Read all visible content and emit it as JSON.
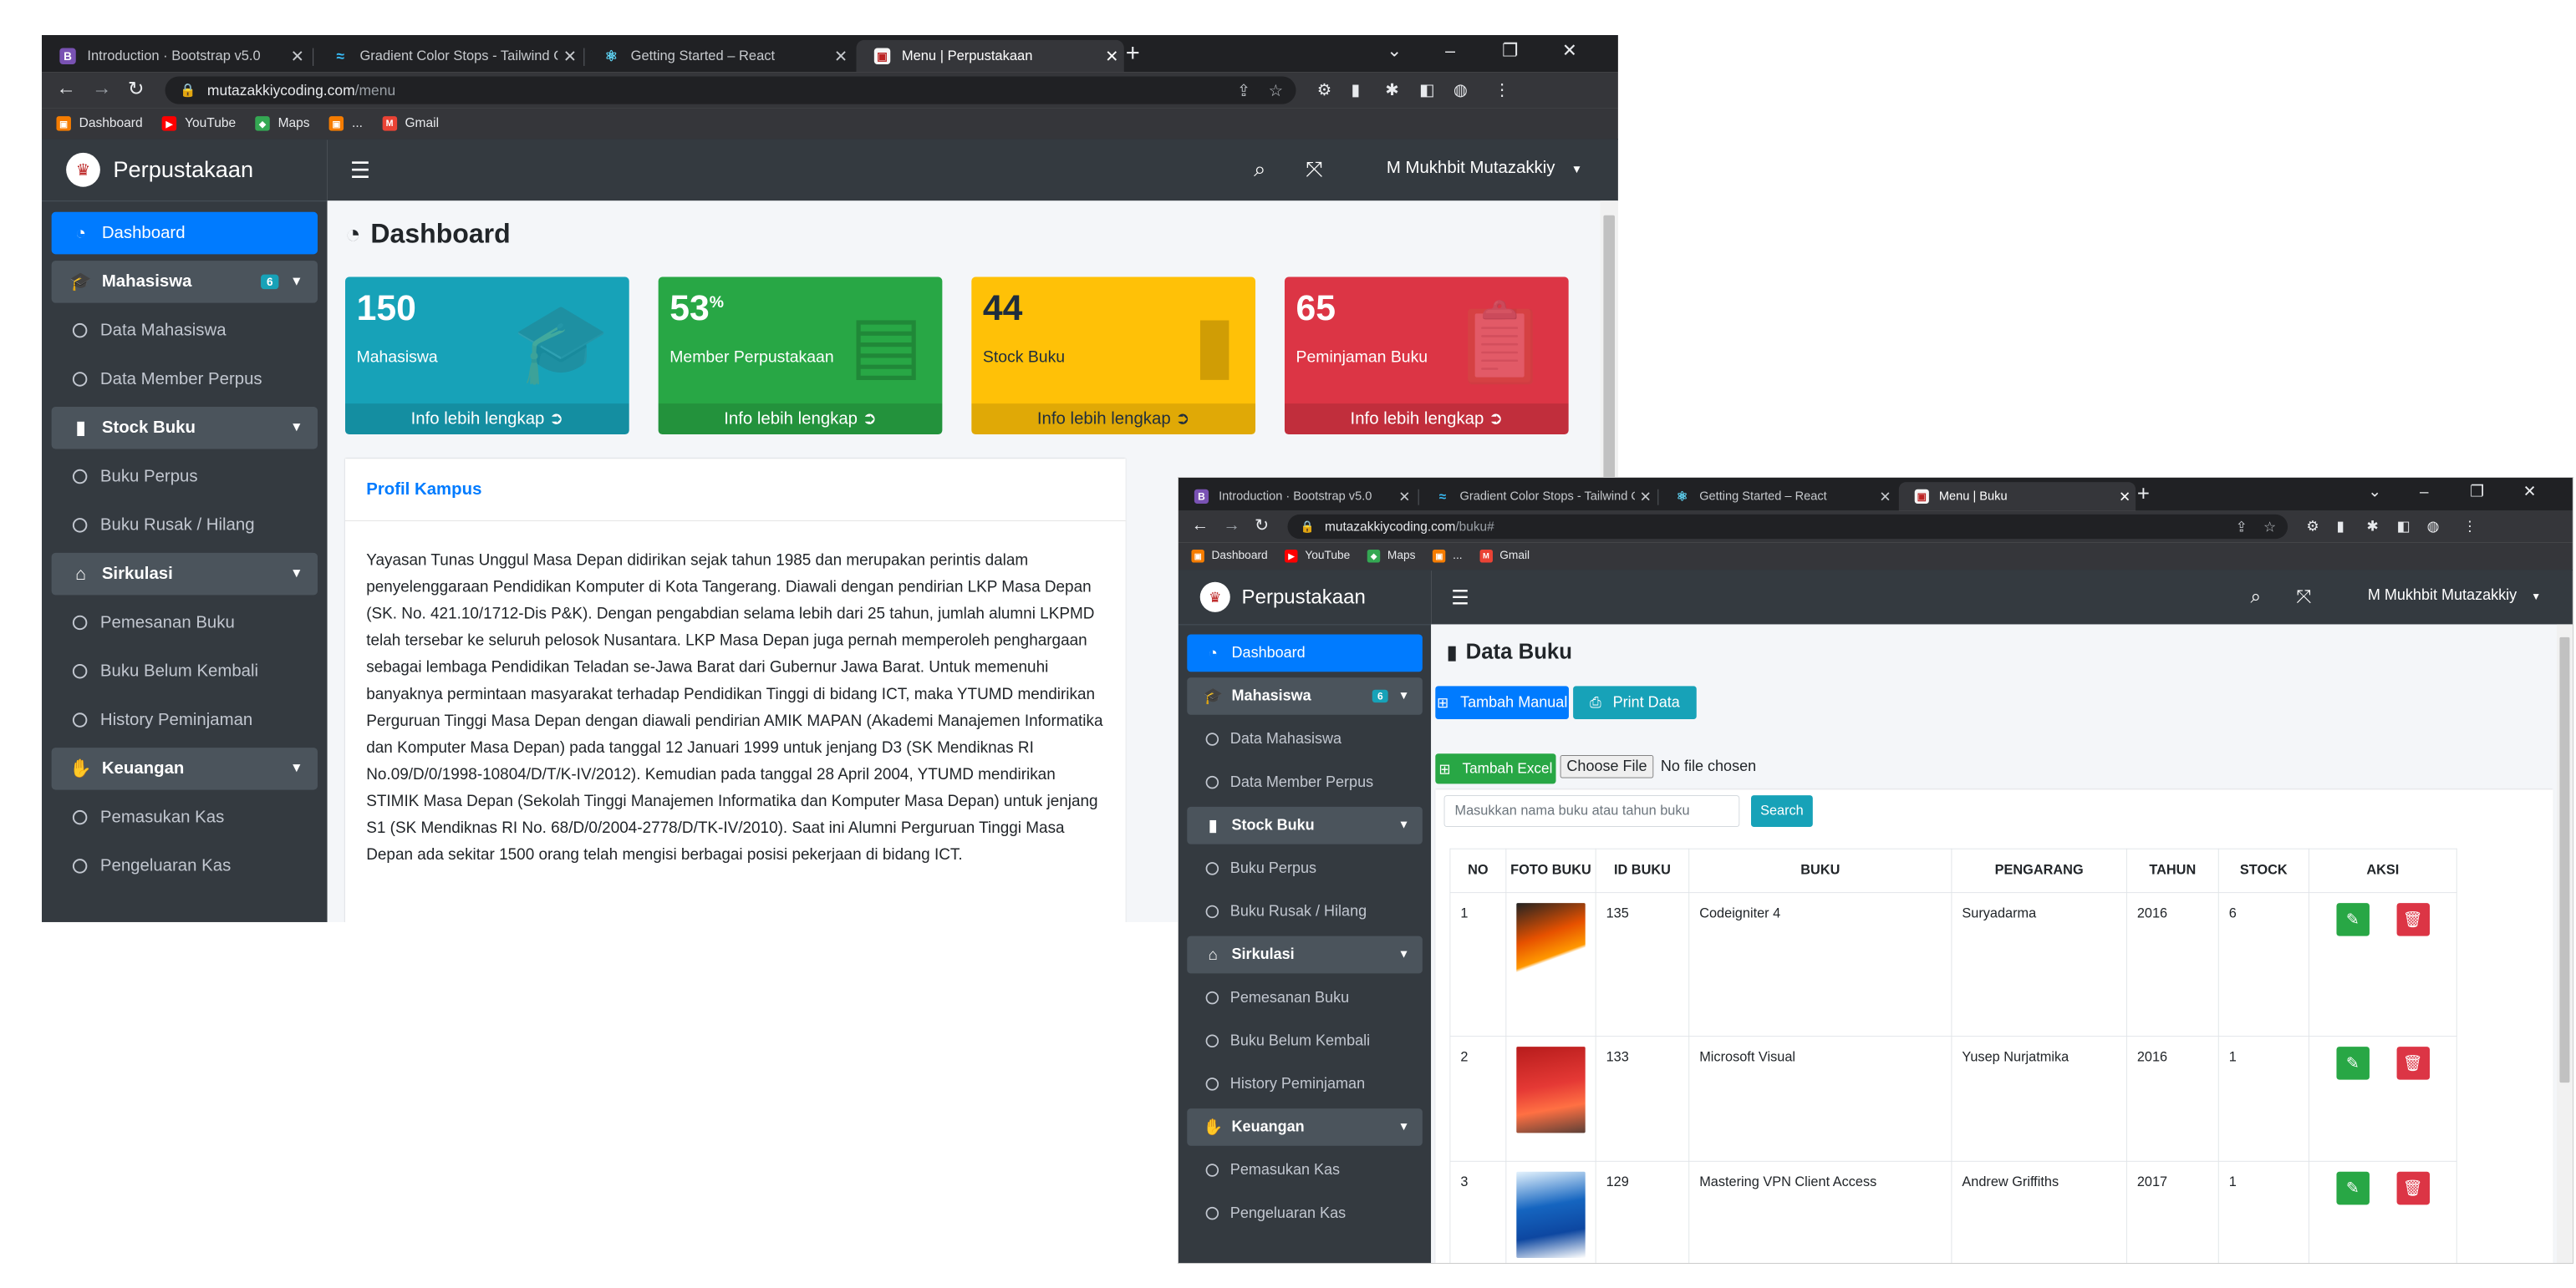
{
  "browser": {
    "tabs": [
      {
        "title": "Introduction · Bootstrap v5.0",
        "icon": "bootstrap-icon"
      },
      {
        "title": "Gradient Color Stops - Tailwind C",
        "icon": "tailwind-icon"
      },
      {
        "title": "Getting Started – React",
        "icon": "react-icon"
      }
    ],
    "bookmarks": [
      "Dashboard",
      "YouTube",
      "Maps",
      "...",
      "Gmail"
    ]
  },
  "window1": {
    "active_tab_title": "Menu | Perpustakaan",
    "url_host": "mutazakkiycoding.com",
    "url_path": "/menu"
  },
  "window2": {
    "active_tab_title": "Menu | Buku",
    "url_host": "mutazakkiycoding.com",
    "url_path": "/buku#"
  },
  "app": {
    "brand": "Perpustakaan",
    "user_name": "M Mukhbit Mutazakkiy",
    "sidebar": [
      {
        "label": "Dashboard",
        "type": "active",
        "icon": "dashboard-icon"
      },
      {
        "label": "Mahasiswa",
        "type": "group",
        "icon": "graduate-icon",
        "badge": "6"
      },
      {
        "label": "Data Mahasiswa",
        "type": "item"
      },
      {
        "label": "Data Member Perpus",
        "type": "item"
      },
      {
        "label": "Stock Buku",
        "type": "group",
        "icon": "book-icon"
      },
      {
        "label": "Buku Perpus",
        "type": "item"
      },
      {
        "label": "Buku Rusak / Hilang",
        "type": "item"
      },
      {
        "label": "Sirkulasi",
        "type": "group",
        "icon": "store-icon"
      },
      {
        "label": "Pemesanan Buku",
        "type": "item"
      },
      {
        "label": "Buku Belum Kembali",
        "type": "item"
      },
      {
        "label": "History Peminjaman",
        "type": "item"
      },
      {
        "label": "Keuangan",
        "type": "group",
        "icon": "hand-money-icon"
      },
      {
        "label": "Pemasukan Kas",
        "type": "item"
      },
      {
        "label": "Pengeluaran Kas",
        "type": "item"
      }
    ]
  },
  "dashboard": {
    "title": "Dashboard",
    "boxes": [
      {
        "value": "150",
        "suffix": "",
        "label": "Mahasiswa",
        "footer": "Info lebih lengkap",
        "color": "#17a2b8",
        "icon": "graduate-icon"
      },
      {
        "value": "53",
        "suffix": "%",
        "label": "Member Perpustakaan",
        "footer": "Info lebih lengkap",
        "color": "#28a745",
        "icon": "id-card-icon"
      },
      {
        "value": "44",
        "suffix": "",
        "label": "Stock Buku",
        "footer": "Info lebih lengkap",
        "color": "#ffc107",
        "icon": "book-icon"
      },
      {
        "value": "65",
        "suffix": "",
        "label": "Peminjaman Buku",
        "footer": "Info lebih lengkap",
        "color": "#dc3545",
        "icon": "clipboard-icon"
      }
    ],
    "profile_title": "Profil Kampus",
    "profile_text": "Yayasan Tunas Unggul Masa Depan didirikan sejak tahun 1985 dan merupakan perintis dalam penyelenggaraan Pendidikan Komputer di Kota Tangerang. Diawali dengan pendirian LKP Masa Depan (SK. No. 421.10/1712-Dis P&K). Dengan pengabdian selama lebih dari 25 tahun, jumlah alumni LKPMD telah tersebar ke seluruh pelosok Nusantara. LKP Masa Depan juga pernah memperoleh penghargaan sebagai lembaga Pendidikan Teladan se-Jawa Barat dari Gubernur Jawa Barat. Untuk memenuhi banyaknya permintaan masyarakat terhadap Pendidikan Tinggi di bidang ICT, maka YTUMD mendirikan Perguruan Tinggi Masa Depan dengan diawali pendirian AMIK MAPAN (Akademi Manajemen Informatika dan Komputer Masa Depan) pada tanggal 12 Januari 1999 untuk jenjang D3 (SK Mendiknas RI No.09/D/0/1998-10804/D/T/K-IV/2012). Kemudian pada tanggal 28 April 2004, YTUMD mendirikan STIMIK Masa Depan (Sekolah Tinggi Manajemen Informatika dan Komputer Masa Depan) untuk jenjang S1 (SK Mendiknas RI No. 68/D/0/2004-2778/D/TK-IV/2010). Saat ini Alumni Perguruan Tinggi Masa Depan ada sekitar 1500 orang telah mengisi berbagai posisi pekerjaan di bidang ICT."
  },
  "buku": {
    "title": "Data Buku",
    "btn_tambah_manual": "Tambah Manual",
    "btn_print": "Print Data",
    "btn_tambah_excel": "Tambah Excel",
    "file_button": "Choose File",
    "file_status": "No file chosen",
    "search_placeholder": "Masukkan nama buku atau tahun buku",
    "search_button": "Search",
    "columns": [
      "NO",
      "FOTO BUKU",
      "ID BUKU",
      "BUKU",
      "PENGARANG",
      "TAHUN",
      "STOCK",
      "AKSI"
    ],
    "rows": [
      {
        "no": "1",
        "id": "135",
        "buku": "Codeigniter 4",
        "pengarang": "Suryadarma",
        "tahun": "2016",
        "stock": "6"
      },
      {
        "no": "2",
        "id": "133",
        "buku": "Microsoft Visual",
        "pengarang": "Yusep Nurjatmika",
        "tahun": "2016",
        "stock": "1"
      },
      {
        "no": "3",
        "id": "129",
        "buku": "Mastering VPN Client Access",
        "pengarang": "Andrew Griffiths",
        "tahun": "2017",
        "stock": "1"
      }
    ]
  }
}
